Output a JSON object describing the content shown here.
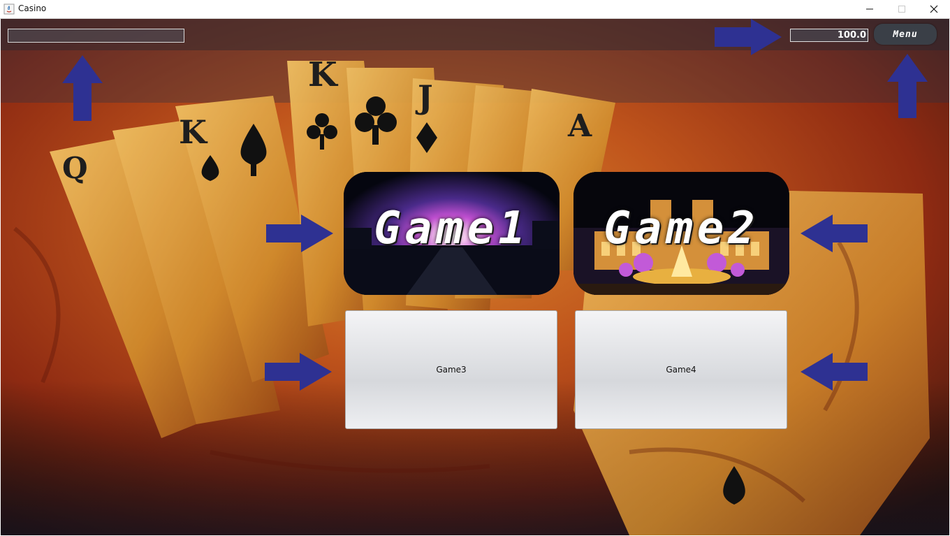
{
  "window": {
    "title": "Casino"
  },
  "top_bar": {
    "name_value": "",
    "balance": "100.0",
    "menu_label": "Menu"
  },
  "games": [
    {
      "label": "Game1"
    },
    {
      "label": "Game2"
    },
    {
      "label": "Game3"
    },
    {
      "label": "Game4"
    }
  ],
  "colors": {
    "arrow": "#2e3192",
    "background_warm": "#b8521c",
    "menu_button": "#3a3f47"
  }
}
